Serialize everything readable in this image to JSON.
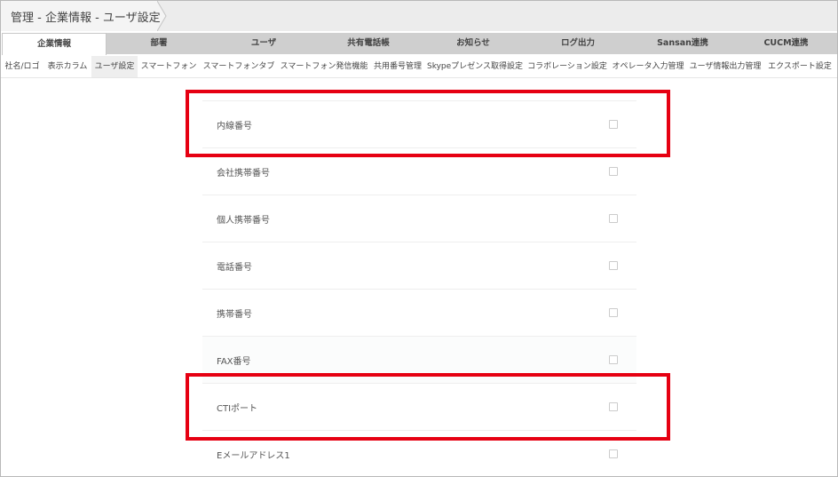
{
  "breadcrumb": {
    "text": "管理 - 企業情報 - ユーザ設定"
  },
  "main_tabs": [
    {
      "label": "企業情報",
      "active": true
    },
    {
      "label": "部署",
      "active": false
    },
    {
      "label": "ユーザ",
      "active": false
    },
    {
      "label": "共有電話帳",
      "active": false
    },
    {
      "label": "お知らせ",
      "active": false
    },
    {
      "label": "ログ出力",
      "active": false
    },
    {
      "label": "Sansan連携",
      "active": false
    },
    {
      "label": "CUCM連携",
      "active": false
    }
  ],
  "sub_tabs": [
    {
      "label": "社名/ロゴ",
      "active": false
    },
    {
      "label": "表示カラム",
      "active": false
    },
    {
      "label": "ユーザ設定",
      "active": true
    },
    {
      "label": "スマートフォン",
      "active": false
    },
    {
      "label": "スマートフォンタブ",
      "active": false
    },
    {
      "label": "スマートフォン発信機能",
      "active": false
    },
    {
      "label": "共用番号管理",
      "active": false
    },
    {
      "label": "Skypeプレゼンス取得設定",
      "active": false
    },
    {
      "label": "コラボレーション設定",
      "active": false
    },
    {
      "label": "オペレータ入力管理",
      "active": false
    },
    {
      "label": "ユーザ情報出力管理",
      "active": false
    },
    {
      "label": "エクスポート設定",
      "active": false
    }
  ],
  "fields": [
    {
      "label": "内線番号",
      "checked": false,
      "highlighted": true
    },
    {
      "label": "会社携帯番号",
      "checked": false,
      "highlighted": false
    },
    {
      "label": "個人携帯番号",
      "checked": false,
      "highlighted": false
    },
    {
      "label": "電話番号",
      "checked": false,
      "highlighted": false
    },
    {
      "label": "携帯番号",
      "checked": false,
      "highlighted": false
    },
    {
      "label": "FAX番号",
      "checked": false,
      "highlighted": false
    },
    {
      "label": "CTIポート",
      "checked": false,
      "highlighted": true
    },
    {
      "label": "Eメールアドレス1",
      "checked": false,
      "highlighted": false
    }
  ],
  "colors": {
    "highlight": "#e60012",
    "tab_active_bg": "#ffffff",
    "tab_inactive_bg": "#cfcfcf",
    "subtab_active_bg": "#eeeeee"
  }
}
